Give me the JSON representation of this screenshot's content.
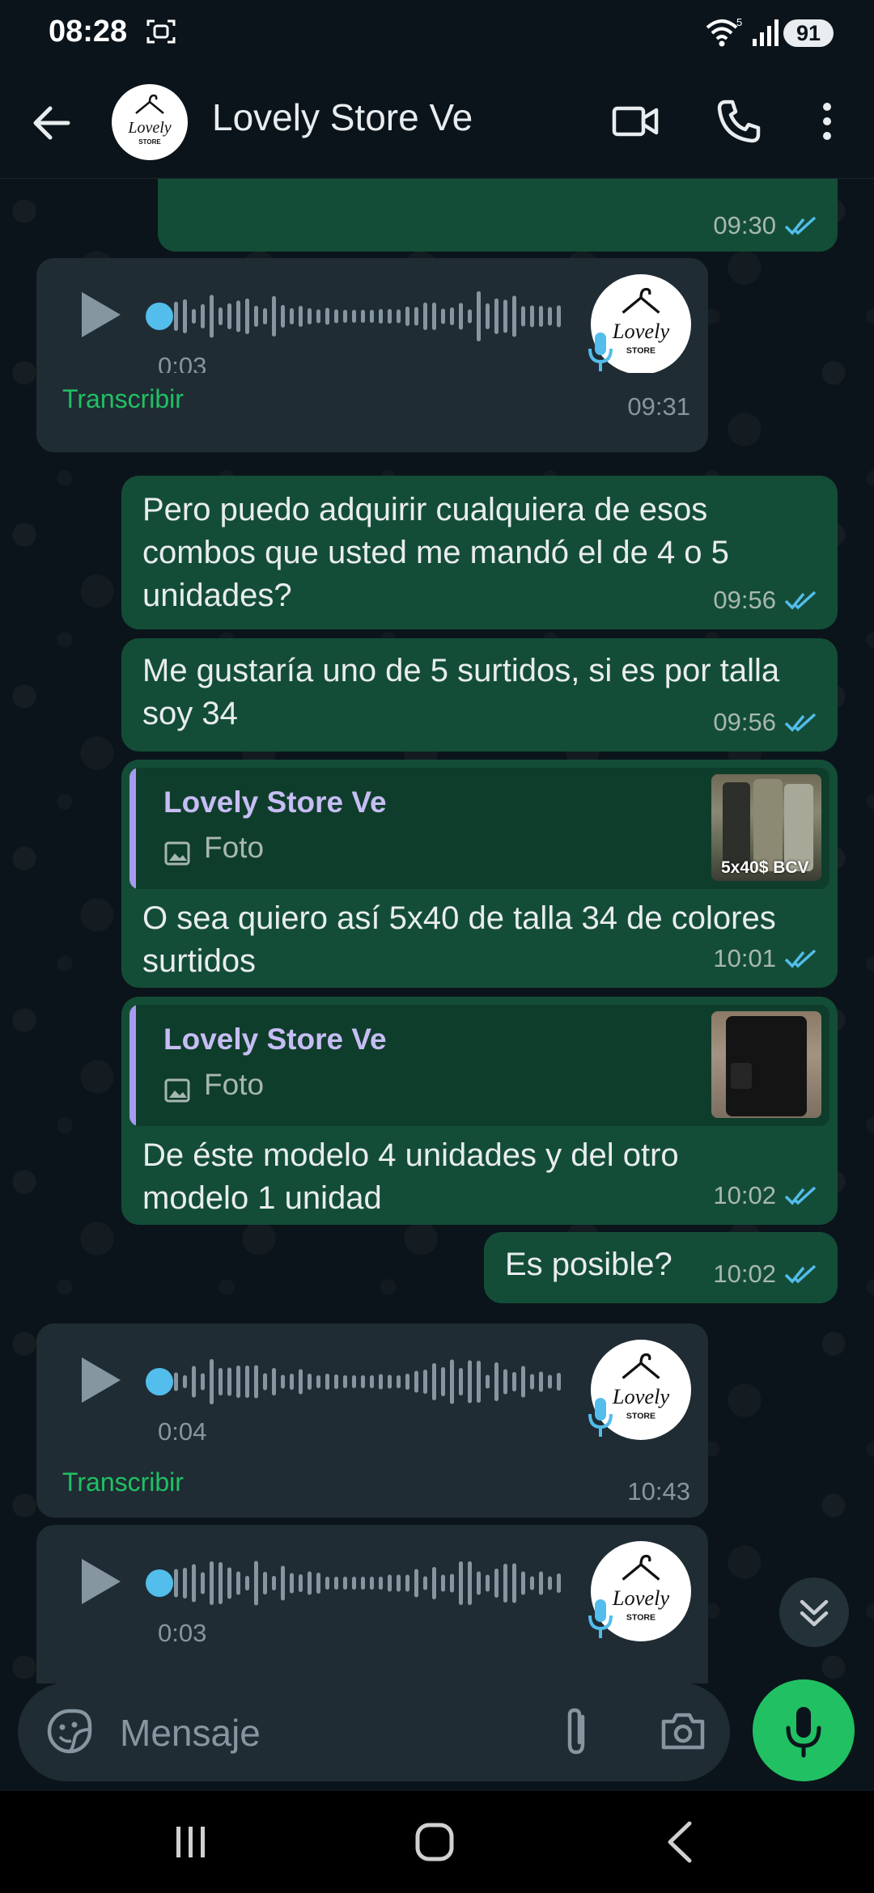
{
  "status_bar": {
    "time": "08:28",
    "battery": "91"
  },
  "header": {
    "contact_name": "Lovely Store Ve"
  },
  "avatar_logo": {
    "top": "Lovely",
    "bottom": "STORE"
  },
  "messages": [
    {
      "id": "m0",
      "type": "text",
      "direction": "outgoing",
      "text": "",
      "time": "09:30",
      "status": "read"
    },
    {
      "id": "m1",
      "type": "voice",
      "direction": "incoming",
      "duration": "0:03",
      "action": "Transcribir",
      "time": "09:31"
    },
    {
      "id": "m2",
      "type": "text",
      "direction": "outgoing",
      "text": "Pero puedo adquirir cualquiera de esos combos que usted me mandó el de 4 o 5 unidades?",
      "time": "09:56",
      "status": "read"
    },
    {
      "id": "m3",
      "type": "text",
      "direction": "outgoing",
      "text": "Me gustaría uno de 5 surtidos, si es por talla soy 34",
      "time": "09:56",
      "status": "read"
    },
    {
      "id": "m4",
      "type": "reply",
      "direction": "outgoing",
      "quoted_name": "Lovely Store Ve",
      "quoted_type": "Foto",
      "thumb_caption": "5x40$ BCV",
      "text": "O sea quiero así 5x40 de talla 34 de colores surtidos",
      "time": "10:01",
      "status": "read"
    },
    {
      "id": "m5",
      "type": "reply",
      "direction": "outgoing",
      "quoted_name": "Lovely Store Ve",
      "quoted_type": "Foto",
      "text": "De éste modelo 4 unidades y del otro modelo 1 unidad",
      "time": "10:02",
      "status": "read"
    },
    {
      "id": "m6",
      "type": "text",
      "direction": "outgoing",
      "text": "Es posible?",
      "time": "10:02",
      "status": "read"
    },
    {
      "id": "m7",
      "type": "voice",
      "direction": "incoming",
      "duration": "0:04",
      "action": "Transcribir",
      "time": "10:43"
    },
    {
      "id": "m8",
      "type": "voice",
      "direction": "incoming",
      "duration": "0:03"
    }
  ],
  "composer": {
    "placeholder": "Mensaje"
  },
  "colors": {
    "accent_green": "#21c063",
    "outgoing_bubble": "#144d37",
    "incoming_bubble": "#1f2c34",
    "read_ticks": "#53bdeb",
    "quote_bar": "#a89af0"
  },
  "icons": [
    "screen-record-icon",
    "wifi-icon",
    "signal-icon",
    "back-arrow-icon",
    "video-call-icon",
    "phone-icon",
    "more-options-icon",
    "play-icon",
    "mic-badge-icon",
    "double-check-icon",
    "photo-icon",
    "chevron-double-down-icon",
    "sticker-icon",
    "attach-icon",
    "camera-icon",
    "mic-icon",
    "nav-recents-icon",
    "nav-home-icon",
    "nav-back-icon"
  ]
}
